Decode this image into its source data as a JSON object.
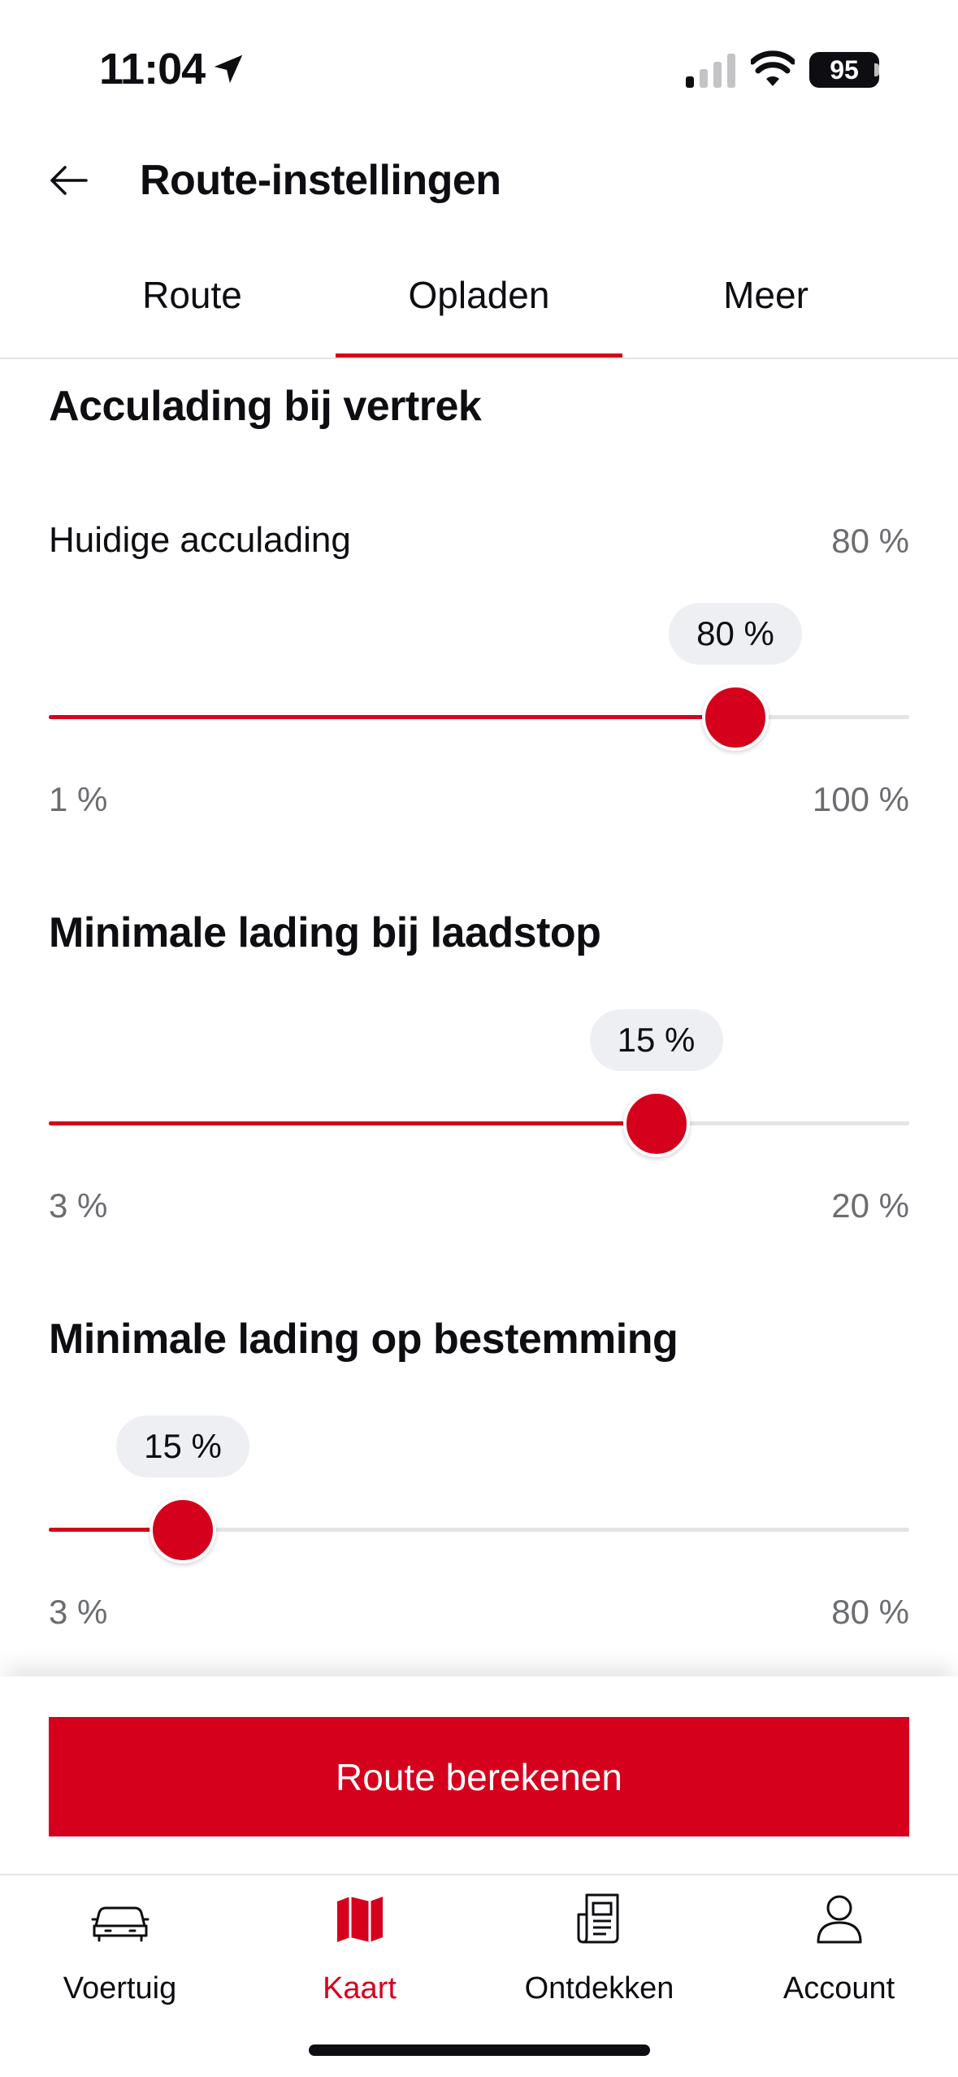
{
  "status_bar": {
    "time": "11:04",
    "battery": "95"
  },
  "header": {
    "title": "Route-instellingen"
  },
  "tabs": [
    {
      "label": "Route",
      "active": false
    },
    {
      "label": "Opladen",
      "active": true
    },
    {
      "label": "Meer",
      "active": false
    }
  ],
  "sections": {
    "departure": {
      "title": "Acculading bij vertrek",
      "row_label": "Huidige acculading",
      "row_value": "80 %",
      "slider": {
        "value": 80,
        "min": 1,
        "max": 100,
        "bubble": "80 %",
        "min_label": "1 %",
        "max_label": "100 %"
      }
    },
    "charging_stop": {
      "title": "Minimale lading bij laadstop",
      "slider": {
        "value": 15,
        "min": 3,
        "max": 20,
        "bubble": "15 %",
        "min_label": "3 %",
        "max_label": "20 %"
      }
    },
    "destination": {
      "title": "Minimale lading op bestemming",
      "slider": {
        "value": 15,
        "min": 3,
        "max": 80,
        "bubble": "15 %",
        "min_label": "3 %",
        "max_label": "80 %"
      }
    }
  },
  "cta": {
    "label": "Route berekenen"
  },
  "nav": [
    {
      "label": "Voertuig",
      "icon": "car-icon",
      "active": false
    },
    {
      "label": "Kaart",
      "icon": "map-icon",
      "active": true
    },
    {
      "label": "Ontdekken",
      "icon": "news-icon",
      "active": false
    },
    {
      "label": "Account",
      "icon": "user-icon",
      "active": false
    }
  ],
  "colors": {
    "accent": "#d5001c",
    "track": "#e3e4e5",
    "text": "#0e0e12",
    "muted": "#6b6d70",
    "bubble": "#eeeff2"
  }
}
